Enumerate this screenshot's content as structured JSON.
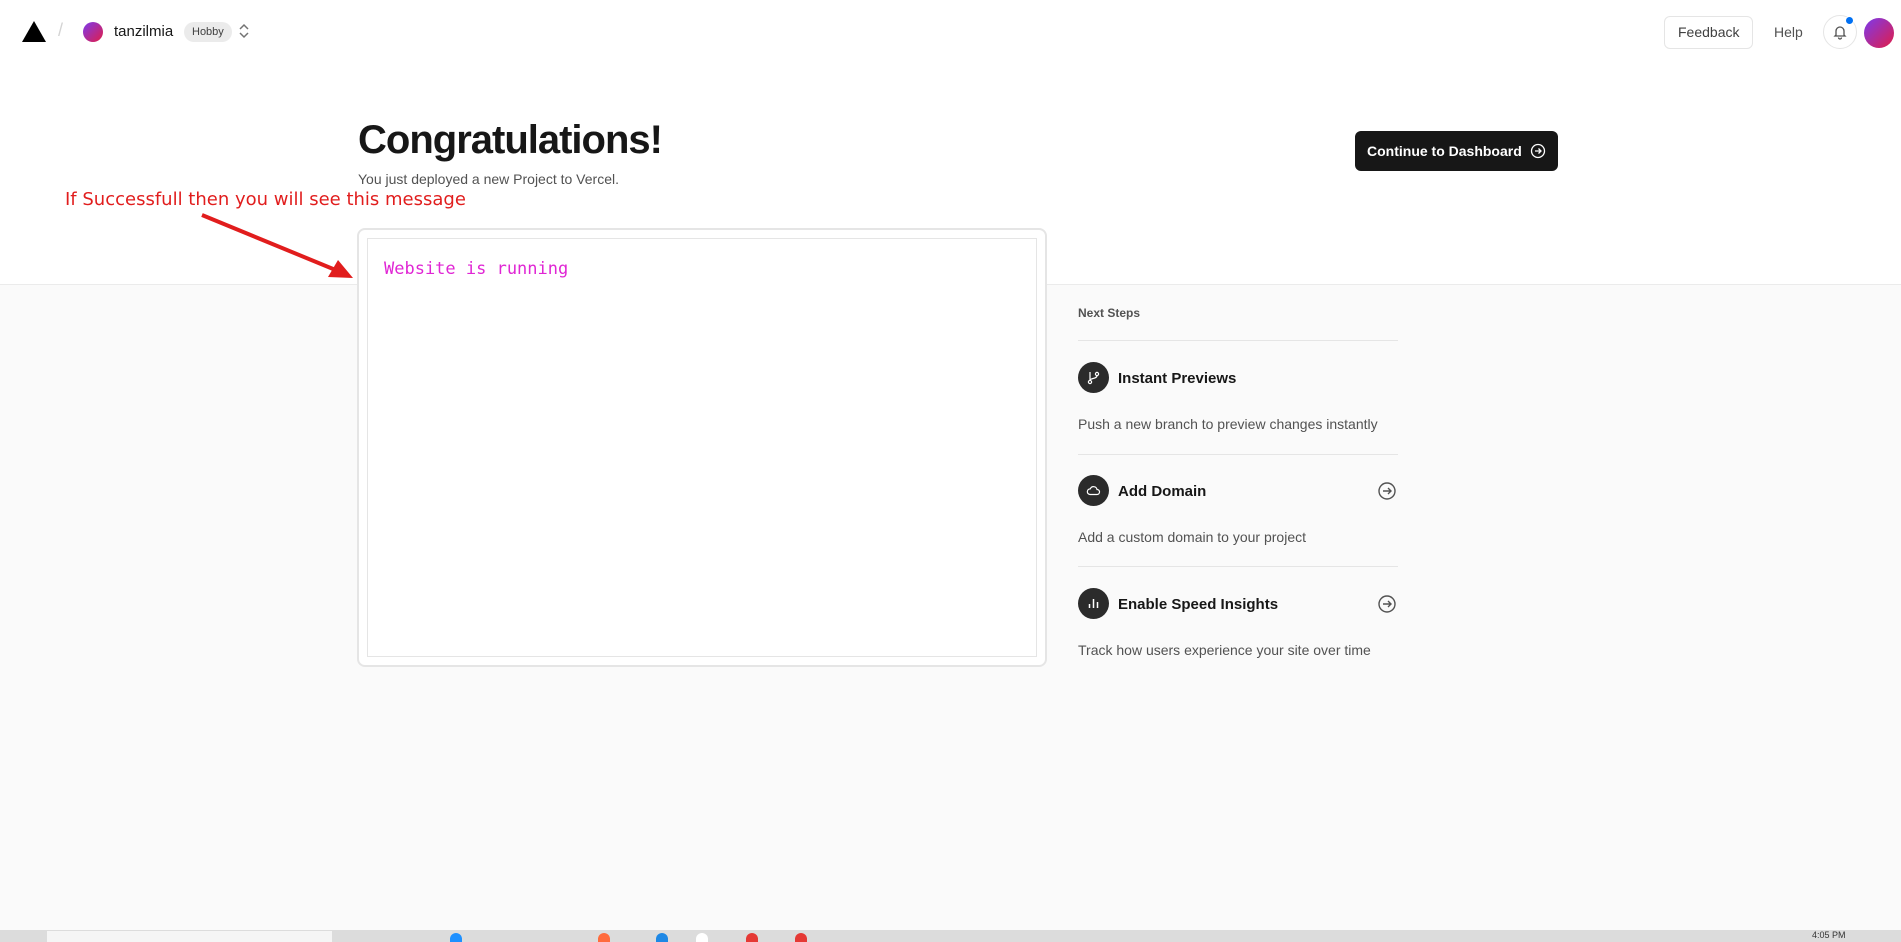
{
  "header": {
    "team_name": "tanzilmia",
    "plan": "Hobby",
    "feedback_label": "Feedback",
    "help_label": "Help"
  },
  "hero": {
    "title": "Congratulations!",
    "subtitle": "You just deployed a new Project to Vercel.",
    "dashboard_button": "Continue to Dashboard"
  },
  "annotation": {
    "text": "If Successfull then you will see this message"
  },
  "preview": {
    "text": "Website is running"
  },
  "next_steps": {
    "heading": "Next Steps",
    "items": [
      {
        "icon": "git-branch-icon",
        "title": "Instant Previews",
        "desc": "Push a new branch to preview changes instantly",
        "has_arrow": false
      },
      {
        "icon": "cloud-icon",
        "title": "Add Domain",
        "desc": "Add a custom domain to your project",
        "has_arrow": true
      },
      {
        "icon": "bar-chart-icon",
        "title": "Enable Speed Insights",
        "desc": "Track how users experience your site over time",
        "has_arrow": true
      }
    ]
  },
  "taskbar": {
    "time": "4:05 PM"
  },
  "colors": {
    "accent": "#171717",
    "annotation": "#e11d1d",
    "preview_text": "#e026d4",
    "notification": "#0070f3"
  }
}
